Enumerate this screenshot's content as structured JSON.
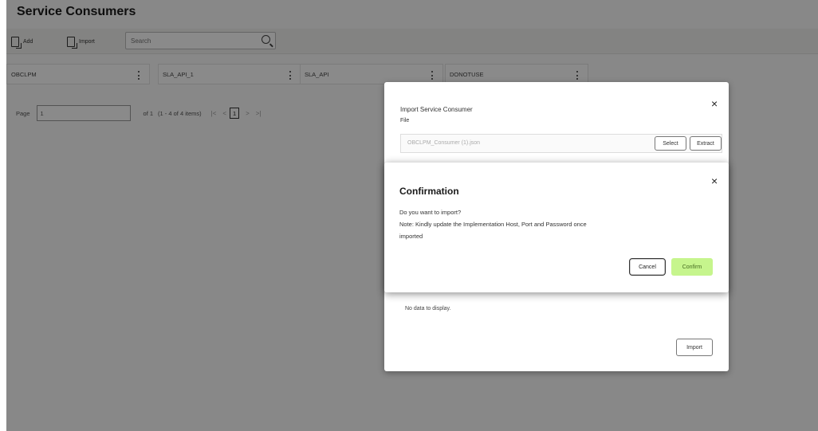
{
  "page": {
    "title": "Service Consumers",
    "toolbar": {
      "add_label": "Add",
      "import_label": "Import",
      "search_placeholder": "Search"
    },
    "cards": [
      {
        "name": "OBCLPM"
      },
      {
        "name": "SLA_API_1"
      },
      {
        "name": "SLA_API"
      },
      {
        "name": "DONOTUSE"
      }
    ],
    "pager": {
      "page_label": "Page",
      "page_value": "1",
      "of_text": "of 1",
      "items_text": "(1 - 4 of 4 items)",
      "first": "|<",
      "prev": "<",
      "current": "1",
      "next": ">",
      "last": ">|"
    }
  },
  "import_dialog": {
    "title": "Import Service Consumer",
    "file_label": "File",
    "file_name": "OBCLPM_Consumer (1).json",
    "select_label": "Select",
    "extract_label": "Extract",
    "no_data": "No data to display.",
    "import_label": "Import",
    "close_glyph": "×"
  },
  "confirmation": {
    "title": "Confirmation",
    "line1": "Do you want to import?",
    "line2": "Note: Kindly update the Implementation Host, Port and Password once",
    "line3": "imported",
    "cancel_label": "Cancel",
    "confirm_label": "Confirm",
    "close_glyph": "×"
  },
  "colors": {
    "confirm_bg": "#c6f58d",
    "overlay": "rgba(0,0,0,0.46)"
  }
}
